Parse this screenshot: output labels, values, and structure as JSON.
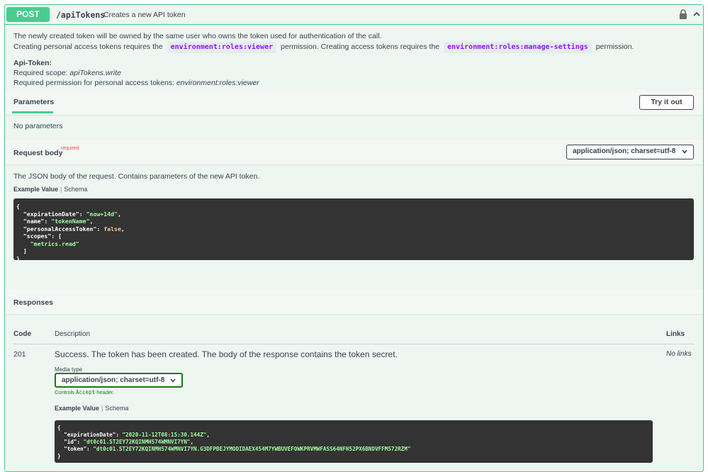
{
  "summary": {
    "method": "POST",
    "path": "/apiTokens",
    "description": "Creates a new API token"
  },
  "description": {
    "line1": "The newly created token will be owned by the same user who owns the token used for authentication of the call.",
    "line2_a": "Creating personal access tokens requires the",
    "line2_code1": "environment:roles:viewer",
    "line2_b": "permission. Creating access tokens requires the",
    "line2_code2": "environment:roles:manage-settings",
    "line2_c": "permission.",
    "api_token_title": "Api-Token:",
    "scope_prefix": "Required scope: ",
    "scope_value": "apiTokens.write",
    "perm_prefix": "Required permission for personal access tokens: ",
    "perm_value": "environment:roles:viewer"
  },
  "parameters": {
    "tab_label": "Parameters",
    "try_button": "Try it out",
    "empty_text": "No parameters"
  },
  "request_body": {
    "title": "Request body",
    "required_label": "required",
    "content_type": "application/json; charset=utf-8",
    "description": "The JSON body of the request. Contains parameters of the new API token.",
    "tab_example": "Example Value",
    "tab_schema": "Schema",
    "example": {
      "expirationDate": "\"now+14d\"",
      "name": "\"tokenName\"",
      "personalAccessToken": "false",
      "scope_item": "\"metrics.read\""
    }
  },
  "responses": {
    "title": "Responses",
    "col_code": "Code",
    "col_description": "Description",
    "col_links": "Links",
    "rows": [
      {
        "code": "201",
        "description": "Success. The token has been created. The body of the response contains the token secret.",
        "links": "No links",
        "media_type_label": "Media type",
        "media_type": "application/json; charset=utf-8",
        "controls_prefix": "Controls ",
        "controls_code": "Accept",
        "controls_suffix": " header.",
        "tab_example": "Example Value",
        "tab_schema": "Schema",
        "example": {
          "expirationDate": "\"2020-11-12T08:15:30.144Z\"",
          "id": "\"dt0c01.ST2EY72KQINMH574WMNVI7YN\"",
          "token": "\"dt0c01.ST2EY72KQINMH574WMNVI7YN.G3DFPBEJYMODIDAEX454M7YWBUVEFOWKPRVMWFASS64NFH52PX6BNDVFFM572RZM\""
        }
      }
    ]
  },
  "colors": {
    "post_green": "#49cc90",
    "block_bg": "#edf6f0",
    "code_bg": "#333333",
    "string_green": "#a2fca2",
    "required_red": "#ff4a4a"
  },
  "icons": [
    "lock-icon",
    "chevron-up-icon",
    "chevron-down-icon"
  ]
}
